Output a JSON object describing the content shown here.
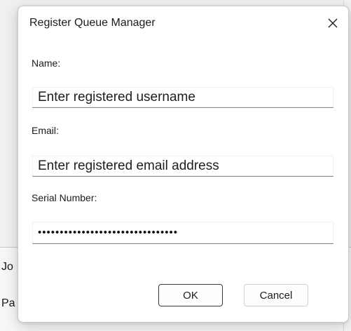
{
  "dialog": {
    "title": "Register Queue Manager",
    "close_glyph": "close-icon"
  },
  "form": {
    "name_label": "Name:",
    "name_placeholder": "Enter registered username",
    "email_label": "Email:",
    "email_placeholder": "Enter registered email address",
    "serial_label": "Serial Number:",
    "serial_value": "••••••••••••••••••••••••••••••••"
  },
  "buttons": {
    "ok_label": "OK",
    "cancel_label": "Cancel"
  },
  "background": {
    "label_1": "Jo",
    "label_2": "Pa"
  }
}
